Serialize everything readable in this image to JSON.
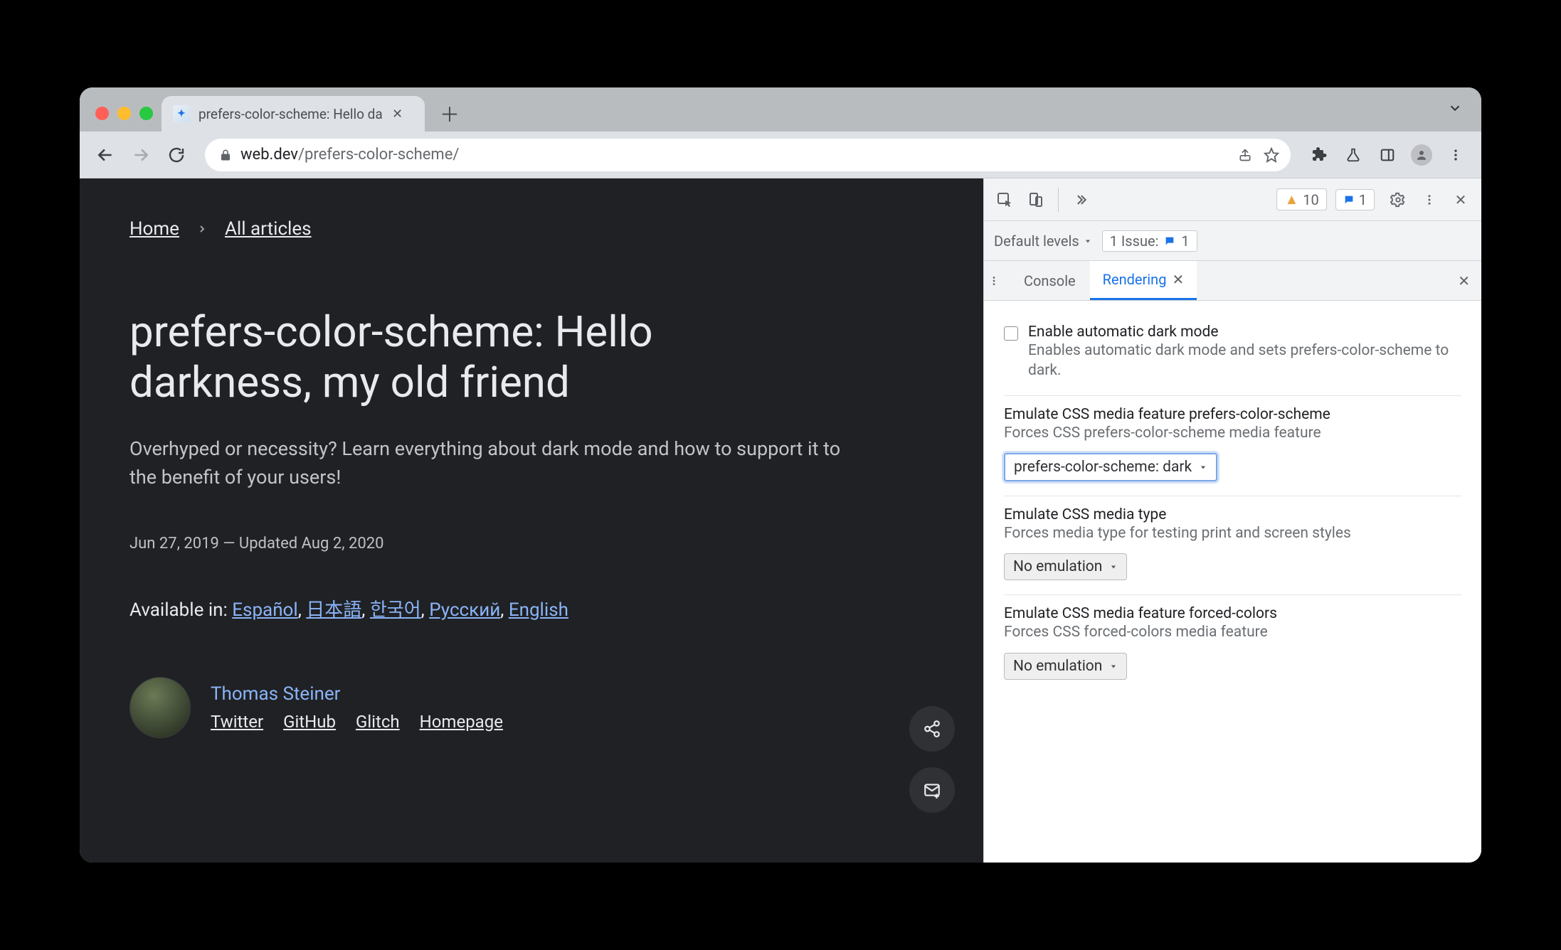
{
  "window": {
    "tab_title": "prefers-color-scheme: Hello da",
    "url_host": "web.dev",
    "url_path": "/prefers-color-scheme/"
  },
  "page": {
    "breadcrumbs": {
      "home": "Home",
      "all": "All articles"
    },
    "title": "prefers-color-scheme: Hello darkness, my old friend",
    "subtitle": "Overhyped or necessity? Learn everything about dark mode and how to support it to the benefit of your users!",
    "dates": "Jun 27, 2019 — Updated Aug 2, 2020",
    "available_label": "Available in: ",
    "langs": [
      "Español",
      "日本語",
      "한국어",
      "Русский",
      "English"
    ],
    "author": {
      "name": "Thomas Steiner",
      "links": [
        "Twitter",
        "GitHub",
        "Glitch",
        "Homepage"
      ]
    }
  },
  "devtools": {
    "warnings": "10",
    "infos": "1",
    "row2": {
      "levels": "Default levels",
      "issue_label": "1 Issue:",
      "issue_count": "1"
    },
    "tabs": {
      "console": "Console",
      "rendering": "Rendering"
    },
    "settings": [
      {
        "checkbox": true,
        "title": "Enable automatic dark mode",
        "desc": "Enables automatic dark mode and sets prefers-color-scheme to dark."
      },
      {
        "title": "Emulate CSS media feature prefers-color-scheme",
        "desc": "Forces CSS prefers-color-scheme media feature",
        "select": "prefers-color-scheme: dark",
        "focused": true
      },
      {
        "title": "Emulate CSS media type",
        "desc": "Forces media type for testing print and screen styles",
        "select": "No emulation"
      },
      {
        "title": "Emulate CSS media feature forced-colors",
        "desc": "Forces CSS forced-colors media feature",
        "select": "No emulation"
      }
    ]
  }
}
